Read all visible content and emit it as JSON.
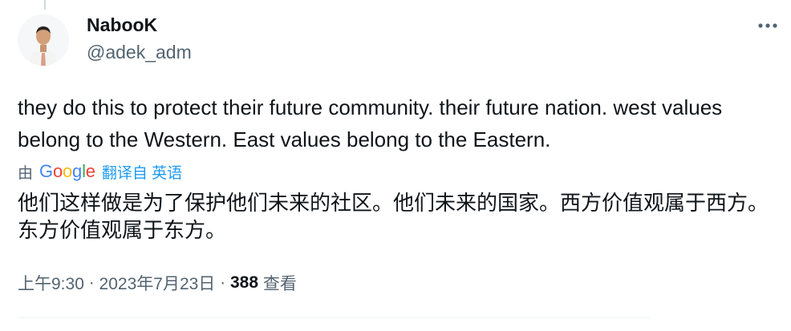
{
  "author": {
    "name": "NabooK",
    "handle": "@adek_adm"
  },
  "tweet": {
    "text": "they do this to protect their future community. their future nation. west values belong to the Western. East values belong to the Eastern."
  },
  "translation": {
    "by": "由",
    "provider": [
      "G",
      "o",
      "o",
      "g",
      "l",
      "e"
    ],
    "link": "翻译自 英语",
    "text": "他们这样做是为了保护他们未来的社区。他们未来的国家。西方价值观属于西方。东方价值观属于东方。"
  },
  "meta": {
    "time": "上午9:30",
    "separator1": " · ",
    "date": "2023年7月23日",
    "separator2": " · ",
    "views_count": "388",
    "views_label": " 查看"
  },
  "colors": {
    "text": "#0f1419",
    "secondary": "#536471",
    "link": "#1d9bf0",
    "google_blue": "#4285F4",
    "google_red": "#EA4335",
    "google_yellow": "#FBBC05",
    "google_green": "#34A853"
  },
  "icons": {
    "more": "more-horizontal-icon",
    "avatar": "avatar"
  }
}
